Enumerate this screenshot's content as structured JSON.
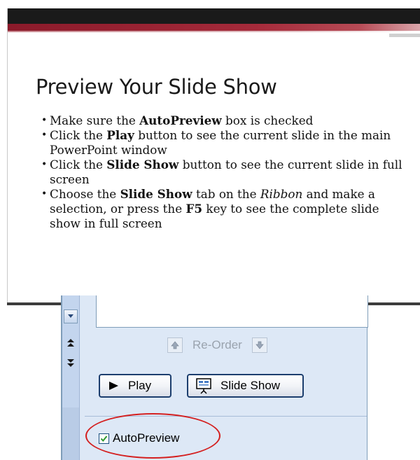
{
  "slide": {
    "title": "Preview Your Slide Show",
    "bullets": [
      {
        "parts": [
          {
            "t": "Make sure the ",
            "s": ""
          },
          {
            "t": "AutoPreview",
            "s": "b"
          },
          {
            "t": " box is checked",
            "s": ""
          }
        ]
      },
      {
        "parts": [
          {
            "t": "Click the ",
            "s": ""
          },
          {
            "t": "Play",
            "s": "b"
          },
          {
            "t": " button to see the current slide in the main PowerPoint window",
            "s": ""
          }
        ]
      },
      {
        "parts": [
          {
            "t": "Click the ",
            "s": ""
          },
          {
            "t": "Slide Show",
            "s": "b"
          },
          {
            "t": " button to see the current slide in full screen",
            "s": ""
          }
        ]
      },
      {
        "parts": [
          {
            "t": "Choose the ",
            "s": ""
          },
          {
            "t": "Slide Show",
            "s": "b"
          },
          {
            "t": " tab on the ",
            "s": ""
          },
          {
            "t": "Ribbon",
            "s": "i"
          },
          {
            "t": " and make a selection, or press the ",
            "s": ""
          },
          {
            "t": "F5",
            "s": "b"
          },
          {
            "t": " key to see the complete slide show in full screen",
            "s": ""
          }
        ]
      }
    ]
  },
  "pane": {
    "reorder_label": "Re-Order",
    "play_label": "Play",
    "slideshow_label": "Slide Show",
    "autopreview_label": "AutoPreview",
    "autopreview_checked": true
  },
  "icons": {
    "scroll_down": "chevron-down-icon",
    "move_up": "move-up-icon",
    "move_down": "move-down-icon",
    "reorder_up": "arrow-up-icon",
    "reorder_down": "arrow-down-icon",
    "play": "play-icon",
    "slideshow": "projector-screen-icon",
    "check": "checkmark-icon"
  },
  "colors": {
    "slide_bar_dark": "#1a1a1a",
    "slide_bar_red": "#a52a3a",
    "pane_bg": "#dde8f6",
    "button_border": "#1c3e6e",
    "highlight": "#d42020",
    "check_green": "#2e9a2e"
  }
}
